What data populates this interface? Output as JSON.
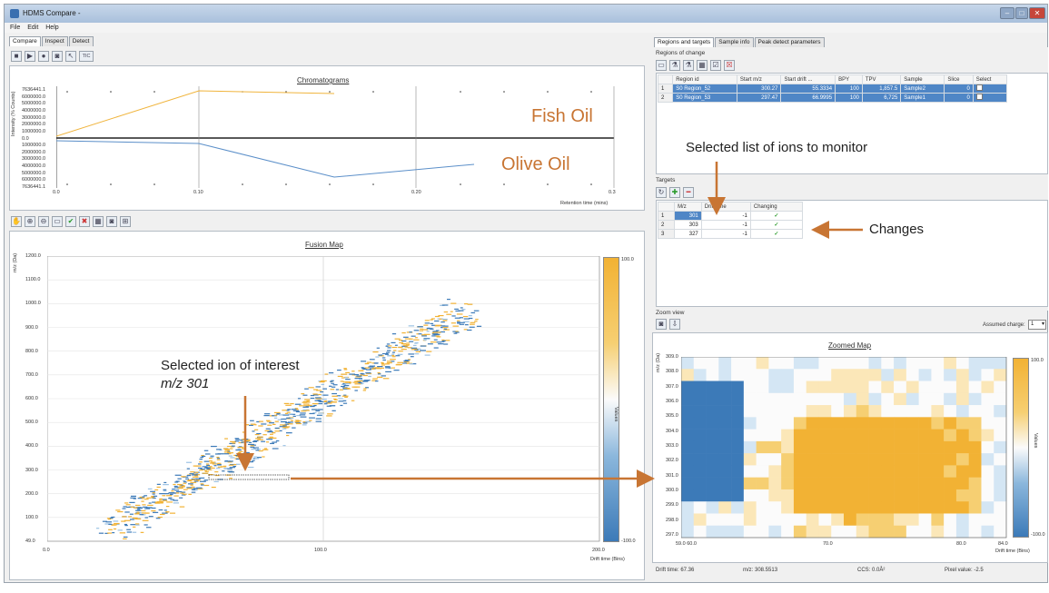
{
  "window": {
    "title": "HDMS Compare -",
    "minimize": "–",
    "maximize": "□",
    "close": "✕"
  },
  "menu": [
    "File",
    "Edit",
    "Help"
  ],
  "left_tabs": [
    "Compare",
    "Inspect",
    "Detect"
  ],
  "right_tabs": [
    "Regions and targets",
    "Sample info",
    "Peak detect parameters"
  ],
  "toolbar_top": {
    "tic_label": "TIC"
  },
  "chromatogram": {
    "title": "Chromatograms",
    "ylabel": "Intensity (% Counts)",
    "y_ticks": [
      "7636441.1",
      "6000000.0",
      "5000000.0",
      "4000000.0",
      "3000000.0",
      "2000000.0",
      "1000000.0",
      "0.0",
      "1000000.0",
      "2000000.0",
      "3000000.0",
      "4000000.0",
      "5000000.0",
      "6000000.0",
      "7636441.1"
    ],
    "x_ticks": [
      "0.0",
      "0.10",
      "0.20",
      "0.3"
    ],
    "xlabel": "Retention time (mins)",
    "label_top": "Fish Oil",
    "label_bottom": "Olive Oil",
    "colors": {
      "top": "#f0b43c",
      "bottom": "#5b8fc9"
    }
  },
  "fusion": {
    "title": "Fusion Map",
    "ylabel": "m/z (Da)",
    "y_ticks": [
      "1200.0",
      "1100.0",
      "1000.0",
      "900.0",
      "800.0",
      "700.0",
      "600.0",
      "500.0",
      "400.0",
      "300.0",
      "200.0",
      "100.0",
      "49.0"
    ],
    "x_ticks": [
      "0.0",
      "100.0",
      "200.0"
    ],
    "xlabel": "Drift time (Bins)",
    "legend_top": "100.0",
    "legend_bottom": "-100.0",
    "legend_label": "Values",
    "annotation_line1": "Selected ion of interest",
    "annotation_line2": "m/z 301"
  },
  "regions": {
    "label": "Regions of change",
    "columns": [
      "",
      "Region id",
      "Start m/z",
      "Start drift ...",
      "BPY",
      "TPV",
      "Sample",
      "Slice",
      "Select"
    ],
    "rows": [
      [
        "1",
        "S0 Region_52",
        "300.27",
        "55.3334",
        "100",
        "1,857.5",
        "Sample2",
        "0",
        ""
      ],
      [
        "2",
        "S0 Region_53",
        "297.47",
        "66.9995",
        "100",
        "6,725",
        "Sample1",
        "0",
        ""
      ]
    ]
  },
  "annotation_ions": "Selected list of ions to monitor",
  "targets": {
    "label": "Targets",
    "columns": [
      "",
      "M/z",
      "Drift time",
      "Changing"
    ],
    "rows": [
      [
        "1",
        "301",
        "-1",
        "✓"
      ],
      [
        "2",
        "303",
        "-1",
        "✓"
      ],
      [
        "3",
        "327",
        "-1",
        "✓"
      ]
    ]
  },
  "annotation_changes": "Changes",
  "zoom": {
    "label": "Zoom view",
    "assumed_charge_label": "Assumed charge:",
    "assumed_charge_value": "1",
    "title": "Zoomed Map",
    "ylabel": "m/z (Da)",
    "y_ticks": [
      "309.0",
      "308.0",
      "307.0",
      "306.0",
      "305.0",
      "304.0",
      "303.0",
      "302.0",
      "301.0",
      "300.0",
      "299.0",
      "298.0",
      "297.0"
    ],
    "x_ticks": [
      "59.0 60.0",
      "70.0",
      "80.0",
      "84.0"
    ],
    "xlabel": "Drift time (Bins)",
    "legend_top": "100.0",
    "legend_bottom": "-100.0",
    "legend_label": "Values"
  },
  "status": {
    "drift": "Drift time: 67.36",
    "mz": "m/z: 308.5513",
    "ccs": "CCS: 0.0Å²",
    "pixel": "Pixel value: -2.5"
  }
}
